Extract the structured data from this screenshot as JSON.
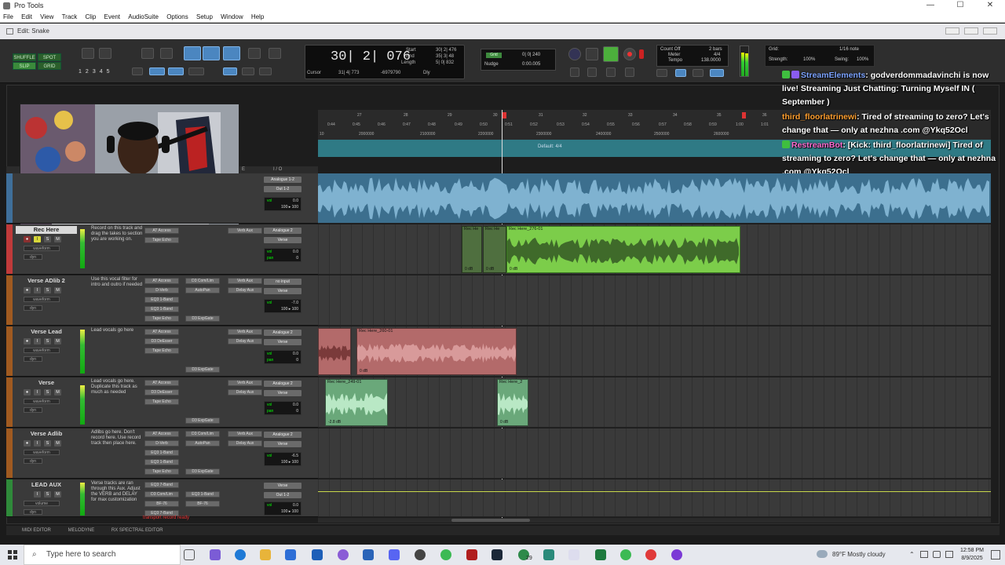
{
  "app": {
    "title": "Pro Tools",
    "window_controls": [
      "—",
      "☐",
      "✕"
    ]
  },
  "menu": [
    "File",
    "Edit",
    "View",
    "Track",
    "Clip",
    "Event",
    "AudioSuite",
    "Options",
    "Setup",
    "Window",
    "Help"
  ],
  "edit_window": {
    "title": "Edit: Snake"
  },
  "toolbar": {
    "modes": [
      "SHUFFLE",
      "SPOT",
      "SLIP",
      "GRID"
    ],
    "zoom_presets": [
      "1",
      "2",
      "3",
      "4",
      "5"
    ],
    "counter_main": "30| 2| 076",
    "start_label": "Start",
    "start_value": "30| 2| 476",
    "end_label": "End",
    "end_value": "35| 3| 48",
    "length_label": "Length",
    "length_value": "5| 0| 832",
    "cursor_label": "Cursor",
    "cursor_value": "31| 4| 773",
    "sample_value": "-6979790",
    "dly_label": "Dly",
    "grid_pill": "Grid",
    "grid_value": "0| 0| 240",
    "nudge_label": "Nudge",
    "nudge_value": "0:00.005",
    "count_off": "Count Off",
    "bars": "2 bars",
    "meter_label": "Meter",
    "meter_value": "4/4",
    "tempo_label": "Tempo",
    "tempo_value": "138.0000",
    "grid_label": "Grid:",
    "grid_note": "1/16 note",
    "strength_label": "Strength:",
    "strength_value": "100%",
    "swing_label": "Swing:",
    "swing_value": "100%"
  },
  "chat": [
    {
      "name": "StreamElements",
      "text": ": godverdommadavinchi is now live! Streaming Just Chatting: Turning Myself IN ( September )",
      "badge_color": "#8a5cf0"
    },
    {
      "name": "third_floorlatrinewi",
      "text": ": Tired of streaming to zero? Let's change that — only at nezhna .com @Ykq52Ocl",
      "badge_color": ""
    },
    {
      "name": "RestreamBot",
      "text": ": [Kick: third_floorlatrinewi] Tired of streaming to zero? Let's change that — only at nezhna .com @Ykq52Ocl",
      "badge_color": "#3fbf3f"
    }
  ],
  "ruler": {
    "bars": [
      "27",
      "28",
      "29",
      "30",
      "31",
      "32",
      "33",
      "34",
      "35",
      "36"
    ],
    "times": [
      "0:44",
      "0:45",
      "0:46",
      "0:47",
      "0:48",
      "0:49",
      "0:50",
      "0:51",
      "0:52",
      "0:53",
      "0:54",
      "0:55",
      "0:56",
      "0:57",
      "0:58",
      "0:59",
      "1:00",
      "1:01"
    ],
    "samples": [
      "10",
      "2000000",
      "2100000",
      "2200000",
      "2300000",
      "2400000",
      "2500000",
      "2600000"
    ],
    "marker": "Default: 4/4"
  },
  "header_labels": {
    "io": "I / O",
    "dot": "E"
  },
  "tracks": [
    {
      "name": "",
      "color": "#3f6f9a",
      "note": "",
      "inserts": [],
      "sends": [],
      "io_in": "Analogue 1-2",
      "io_out": "Out 1-2",
      "vol": "0.0",
      "pan": "100 ▸ 100",
      "view": "",
      "dyn": ""
    },
    {
      "name": "Rec Here",
      "color": "#c03a3a",
      "note": "Record on this track and drag the takes to section you are working on.",
      "inserts": [
        "AT Access",
        "Tape Echo"
      ],
      "sends": [
        "Verb Aux"
      ],
      "io_in": "Analogue 2",
      "io_out": "Verse",
      "vol": "0.0",
      "pan": "0",
      "view": "waveform",
      "dyn": "dyn"
    },
    {
      "name": "Verse ADlib 2",
      "color": "#a05a20",
      "note": "Use this vocal filter for intro and outro if needed",
      "inserts": [
        "AT Access",
        "D-Verb",
        "EQ3 1-Band",
        "EQ3 1-Band",
        "Tape Echo"
      ],
      "sends": [
        "D3 Com/Lim",
        "AutoPan",
        "D3 ExpGate"
      ],
      "sends2": [
        "Verb Aux",
        "Delay Aux"
      ],
      "io_in": "no input",
      "io_out": "Verse",
      "vol": "-7.0",
      "pan": "100 ▸ 100",
      "view": "waveform",
      "dyn": "dyn"
    },
    {
      "name": "Verse Lead",
      "color": "#a05a20",
      "note": "Lead vocals go here",
      "inserts": [
        "AT Access",
        "D3 DeEsser",
        "Tape Echo"
      ],
      "sends": [
        "D3 ExpGate"
      ],
      "sends2": [
        "Verb Aux",
        "Delay Aux"
      ],
      "io_in": "Analogue 2",
      "io_out": "Verse",
      "vol": "0.0",
      "pan": "0",
      "view": "waveform",
      "dyn": "dyn"
    },
    {
      "name": "Verse",
      "color": "#a05a20",
      "note": "Lead vocals go here. Duplicate this track as much as needed",
      "inserts": [
        "AT Access",
        "D3 DeEsser",
        "Tape Echo"
      ],
      "sends": [
        "D3 ExpGate"
      ],
      "sends2": [
        "Verb Aux",
        "Delay Aux"
      ],
      "io_in": "Analogue 2",
      "io_out": "Verse",
      "vol": "0.0",
      "pan": "0",
      "view": "waveform",
      "dyn": "dyn"
    },
    {
      "name": "Verse Adlib",
      "color": "#a05a20",
      "note": "Adlibs go here. Don't record here. Use record track then place here.",
      "inserts": [
        "AT Access",
        "D-Verb",
        "EQ3 1-Band",
        "EQ3 1-Band",
        "Tape Echo"
      ],
      "sends": [
        "D3 Com/Lim",
        "AutoPan",
        "D3 ExpGate"
      ],
      "sends2": [
        "Verb Aux",
        "Delay Aux"
      ],
      "io_in": "Analogue 2",
      "io_out": "Verse",
      "vol": "-6.5",
      "pan": "100 ▸ 100",
      "view": "waveform",
      "dyn": "dyn"
    },
    {
      "name": "LEAD AUX",
      "color": "#2f8a3a",
      "note": "Verse tracks are ran through this Aux. Adjust the VERB and DELAY for max customization",
      "inserts": [
        "EQ3 7-Band",
        "D3 Com/Lim",
        "BF-76",
        "EQ3 7-Band"
      ],
      "sends": [
        "EQ3 1-Band",
        "BF-76"
      ],
      "io_in": "Verse",
      "io_out": "Out 1-2",
      "vol": "0.0",
      "pan": "100 ▸ 100",
      "view": "volume",
      "dyn": "dyn"
    }
  ],
  "clips": {
    "rec_small_1": "Rec He",
    "rec_small_2": "Rec He",
    "rec_main": "Rec Here_276-01",
    "rec_db": "0 dB",
    "lead_main": "Rec Here_260-01",
    "lead_db": "0 dB",
    "verse_1": "Rec Here_249-01",
    "verse_1_db": "-2.8 dB",
    "verse_2": "Rec Here_2",
    "verse_2_db": "0 dB"
  },
  "status_hint": "transport record ready",
  "bottom_tabs": [
    "MIDI EDITOR",
    "MELODYNE",
    "RX SPECTRAL EDITOR"
  ],
  "taskbar": {
    "search_placeholder": "Type here to search",
    "weather": "89°F  Mostly cloudy",
    "time": "12:58 PM",
    "date": "8/9/2025",
    "badge": "29"
  }
}
